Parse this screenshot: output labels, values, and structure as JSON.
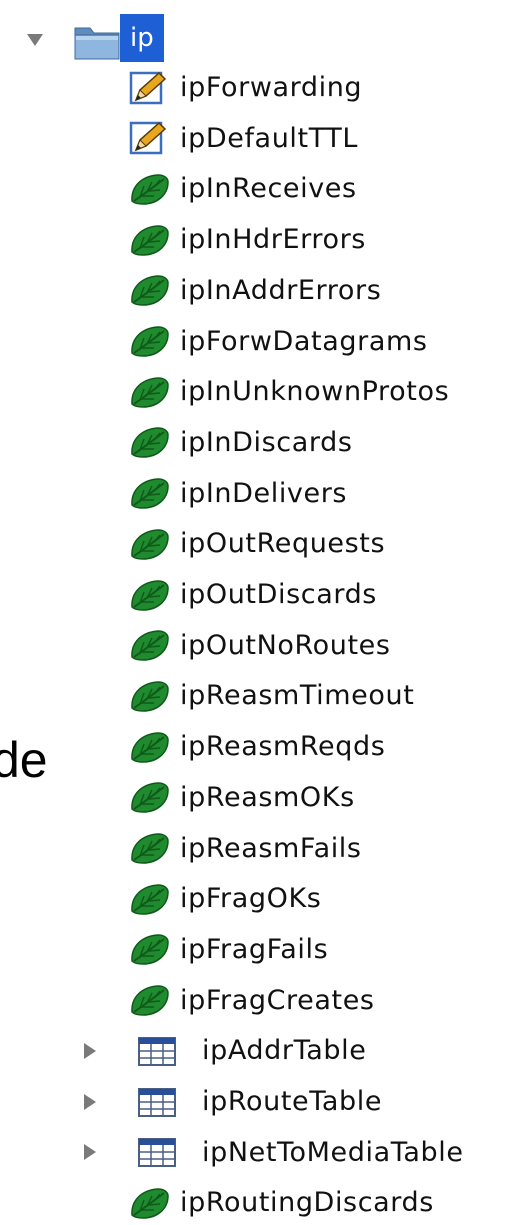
{
  "stray_text": "de",
  "tree": {
    "root": {
      "label": "ip",
      "icon": "folder-icon",
      "expanded": true,
      "selected": true
    },
    "nodes": [
      {
        "label": "ipForwarding",
        "icon": "writable-scalar-icon"
      },
      {
        "label": "ipDefaultTTL",
        "icon": "writable-scalar-icon"
      },
      {
        "label": "ipInReceives",
        "icon": "leaf-icon"
      },
      {
        "label": "ipInHdrErrors",
        "icon": "leaf-icon"
      },
      {
        "label": "ipInAddrErrors",
        "icon": "leaf-icon"
      },
      {
        "label": "ipForwDatagrams",
        "icon": "leaf-icon"
      },
      {
        "label": "ipInUnknownProtos",
        "icon": "leaf-icon"
      },
      {
        "label": "ipInDiscards",
        "icon": "leaf-icon"
      },
      {
        "label": "ipInDelivers",
        "icon": "leaf-icon"
      },
      {
        "label": "ipOutRequests",
        "icon": "leaf-icon"
      },
      {
        "label": "ipOutDiscards",
        "icon": "leaf-icon"
      },
      {
        "label": "ipOutNoRoutes",
        "icon": "leaf-icon"
      },
      {
        "label": "ipReasmTimeout",
        "icon": "leaf-icon"
      },
      {
        "label": "ipReasmReqds",
        "icon": "leaf-icon"
      },
      {
        "label": "ipReasmOKs",
        "icon": "leaf-icon"
      },
      {
        "label": "ipReasmFails",
        "icon": "leaf-icon"
      },
      {
        "label": "ipFragOKs",
        "icon": "leaf-icon"
      },
      {
        "label": "ipFragFails",
        "icon": "leaf-icon"
      },
      {
        "label": "ipFragCreates",
        "icon": "leaf-icon"
      },
      {
        "label": "ipAddrTable",
        "icon": "table-icon",
        "expanded": false
      },
      {
        "label": "ipRouteTable",
        "icon": "table-icon",
        "expanded": false
      },
      {
        "label": "ipNetToMediaTable",
        "icon": "table-icon",
        "expanded": false
      },
      {
        "label": "ipRoutingDiscards",
        "icon": "leaf-icon"
      }
    ]
  },
  "colors": {
    "selection": "#1f5fd6",
    "leaf_green": "#1f8a2e",
    "folder_blue": "#6f9fcf",
    "disclosure_gray": "#7a7a7a"
  }
}
